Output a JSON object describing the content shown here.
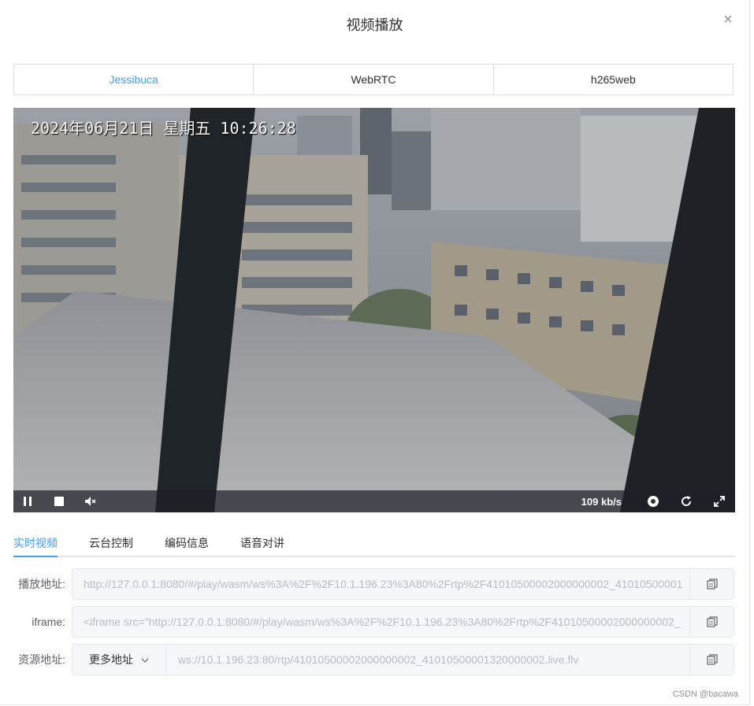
{
  "dialog": {
    "title": "视频播放",
    "close_glyph": "×"
  },
  "player_tabs": [
    {
      "label": "Jessibuca",
      "active": true
    },
    {
      "label": "WebRTC",
      "active": false
    },
    {
      "label": "h265web",
      "active": false
    }
  ],
  "video": {
    "osd_timestamp": "2024年06月21日  星期五 10:26:28",
    "bitrate": "109 kb/s",
    "controls": {
      "pause_icon": "pause-icon",
      "stop_icon": "stop-icon",
      "mute_icon": "volume-icon",
      "screenshot_icon": "camera-icon",
      "reload_icon": "refresh-icon",
      "fullscreen_icon": "fullscreen-icon"
    }
  },
  "info_tabs": [
    {
      "label": "实时视频",
      "active": true
    },
    {
      "label": "云台控制",
      "active": false
    },
    {
      "label": "编码信息",
      "active": false
    },
    {
      "label": "语音对讲",
      "active": false
    }
  ],
  "fields": {
    "play_url": {
      "label": "播放地址:",
      "value": "http://127.0.0.1:8080/#/play/wasm/ws%3A%2F%2F10.1.196.23%3A80%2Frtp%2F41010500002000000002_41010500001"
    },
    "iframe": {
      "label": "iframe:",
      "value": "<iframe src=\"http://127.0.0.1:8080/#/play/wasm/ws%3A%2F%2F10.1.196.23%3A80%2Frtp%2F41010500002000000002_"
    },
    "resource": {
      "label": "资源地址:",
      "select_label": "更多地址",
      "value": "ws://10.1.196.23:80/rtp/41010500002000000002_41010500001320000002.live.flv"
    }
  },
  "watermark": "CSDN @bacawa",
  "colors": {
    "accent": "#409eff",
    "border": "#dcdfe6",
    "disabled_text": "#b8bcc4"
  }
}
